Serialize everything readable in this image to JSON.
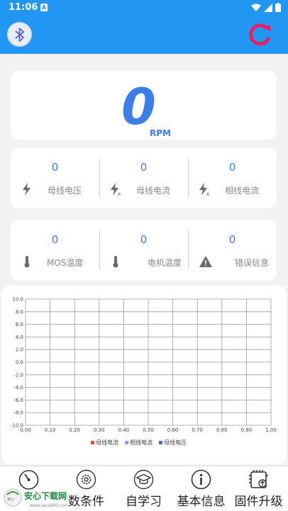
{
  "status_bar": {
    "time": "11:06",
    "notification_icon": "a-letter-icon",
    "icons": [
      "wifi-icon",
      "signal-icon",
      "battery-icon"
    ]
  },
  "header": {
    "left_icon": "bluetooth-icon",
    "right_icon": "refresh-icon",
    "bg_color": "#2196f3",
    "accent_color": "#e91e63"
  },
  "rpm": {
    "value": "0",
    "unit": "RPM"
  },
  "metrics_row1": [
    {
      "value": "0",
      "label": "母线电压",
      "icon": "bolt-icon"
    },
    {
      "value": "0",
      "label": "母线电流",
      "icon": "bolt-a-icon"
    },
    {
      "value": "0",
      "label": "相线电流",
      "icon": "bolt-a-icon"
    }
  ],
  "metrics_row2": [
    {
      "value": "0",
      "label": "MOS温度",
      "icon": "thermometer-icon"
    },
    {
      "value": "0",
      "label": "电机温度",
      "icon": "thermometer-icon"
    },
    {
      "value": "0",
      "label": "错误信息",
      "icon": "warning-icon"
    }
  ],
  "chart_data": {
    "type": "line",
    "x_ticks": [
      "0.00",
      "0.10",
      "0.20",
      "0.30",
      "0.40",
      "0.50",
      "0.60",
      "0.70",
      "0.80",
      "0.90",
      "1.00"
    ],
    "y_ticks": [
      "10.0",
      "8.0",
      "6.0",
      "4.0",
      "2.0",
      "0.0",
      "-2.0",
      "-4.0",
      "-6.0",
      "-8.0",
      "-10.0"
    ],
    "xlim": [
      0,
      1
    ],
    "ylim": [
      -10,
      10
    ],
    "grid": true,
    "legend_position": "bottom",
    "series": [
      {
        "name": "母线电流",
        "color": "#e0504a",
        "values": []
      },
      {
        "name": "相线电流",
        "color": "#7fa6d6",
        "values": []
      },
      {
        "name": "母线电压",
        "color": "#4a6fc6",
        "values": []
      }
    ]
  },
  "nav": [
    {
      "label": "",
      "icon": "gauge-icon"
    },
    {
      "label": "数条件",
      "icon": "gear-icon"
    },
    {
      "label": "自学习",
      "icon": "graduation-cap-icon"
    },
    {
      "label": "基本信息",
      "icon": "info-icon"
    },
    {
      "label": "固件升级",
      "icon": "chip-icon"
    }
  ],
  "watermark": {
    "text": "安心下载网",
    "subtext": "www.java800.com"
  }
}
